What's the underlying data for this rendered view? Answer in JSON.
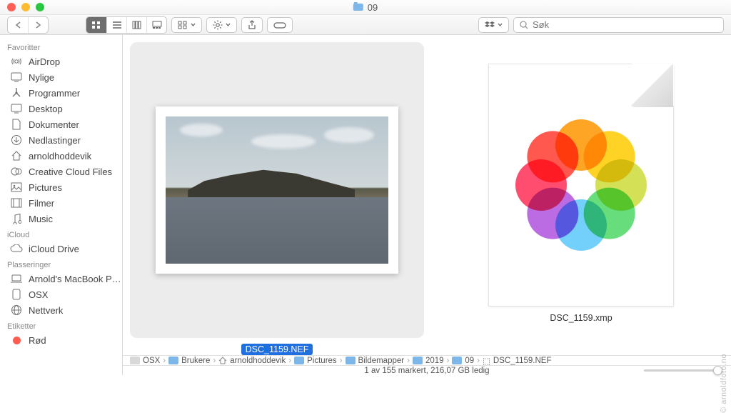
{
  "window": {
    "title": "09"
  },
  "search": {
    "placeholder": "Søk"
  },
  "sidebar": {
    "sections": [
      {
        "heading": "Favoritter",
        "items": [
          {
            "label": "AirDrop",
            "icon": "airdrop-icon"
          },
          {
            "label": "Nylige",
            "icon": "recents-icon"
          },
          {
            "label": "Programmer",
            "icon": "applications-icon"
          },
          {
            "label": "Desktop",
            "icon": "desktop-icon"
          },
          {
            "label": "Dokumenter",
            "icon": "documents-icon"
          },
          {
            "label": "Nedlastinger",
            "icon": "downloads-icon"
          },
          {
            "label": "arnoldhoddevik",
            "icon": "home-icon"
          },
          {
            "label": "Creative Cloud Files",
            "icon": "creative-cloud-icon"
          },
          {
            "label": "Pictures",
            "icon": "pictures-icon"
          },
          {
            "label": "Filmer",
            "icon": "movies-icon"
          },
          {
            "label": "Music",
            "icon": "music-icon"
          }
        ]
      },
      {
        "heading": "iCloud",
        "items": [
          {
            "label": "iCloud Drive",
            "icon": "icloud-icon"
          }
        ]
      },
      {
        "heading": "Plasseringer",
        "items": [
          {
            "label": "Arnold's MacBook P…",
            "icon": "laptop-icon"
          },
          {
            "label": "OSX",
            "icon": "disk-icon"
          },
          {
            "label": "Nettverk",
            "icon": "network-icon"
          }
        ]
      },
      {
        "heading": "Etiketter",
        "items": [
          {
            "label": "Rød",
            "icon": "tag-red",
            "color": "#ff5b4f"
          }
        ]
      }
    ]
  },
  "files": {
    "item1": {
      "name": "DSC_1159.NEF",
      "selected": true
    },
    "item2": {
      "name": "DSC_1159.xmp",
      "selected": false
    }
  },
  "pathbar": {
    "segments": [
      {
        "label": "OSX",
        "kind": "drive"
      },
      {
        "label": "Brukere",
        "kind": "folder"
      },
      {
        "label": "arnoldhoddevik",
        "kind": "home"
      },
      {
        "label": "Pictures",
        "kind": "folder"
      },
      {
        "label": "Bildemapper",
        "kind": "folder"
      },
      {
        "label": "2019",
        "kind": "folder"
      },
      {
        "label": "09",
        "kind": "folder"
      },
      {
        "label": "DSC_1159.NEF",
        "kind": "file"
      }
    ]
  },
  "status": {
    "text": "1 av 155 markert, 216,07 GB ledig"
  },
  "watermark": "© arnoldfoto.no"
}
